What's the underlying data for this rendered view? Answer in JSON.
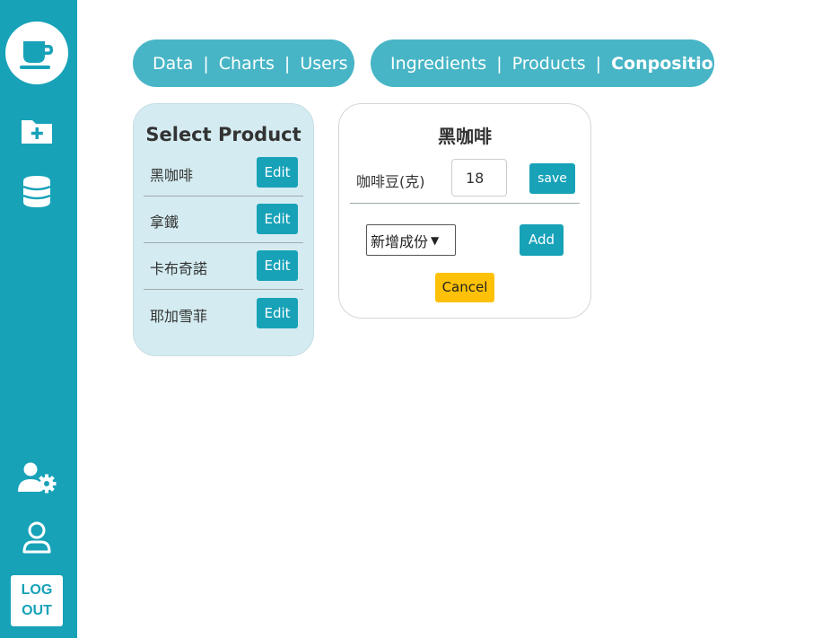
{
  "sidebar": {
    "logo_icon": "coffee-cup-icon",
    "nav_icons": [
      "folder-plus-icon",
      "database-icon"
    ],
    "bottom_icons": [
      "user-settings-icon",
      "user-icon"
    ],
    "logout": {
      "line1": "LOG",
      "line2": "OUT"
    }
  },
  "nav_left": {
    "items": [
      "Data",
      "Charts",
      "Users"
    ],
    "separator": "|"
  },
  "nav_right": {
    "items": [
      "Ingredients",
      "Products",
      "Conposition"
    ],
    "active": "Conposition",
    "separator": "|"
  },
  "select_product": {
    "title": "Select Product",
    "edit_label": "Edit",
    "products": [
      "黑咖啡",
      "拿鐵",
      "卡布奇諾",
      "耶加雪菲"
    ]
  },
  "composition": {
    "title": "黑咖啡",
    "ingredient": {
      "name": "咖啡豆(克)",
      "quantity": "18"
    },
    "save_label": "save",
    "add_select_value": "新增成份",
    "add_label": "Add",
    "cancel_label": "Cancel"
  },
  "colors": {
    "sidebar": "#17a2b8",
    "pill": "#47b5c6",
    "select_panel": "#d4ecf1",
    "button": "#17a2b8",
    "cancel": "#ffc107"
  }
}
